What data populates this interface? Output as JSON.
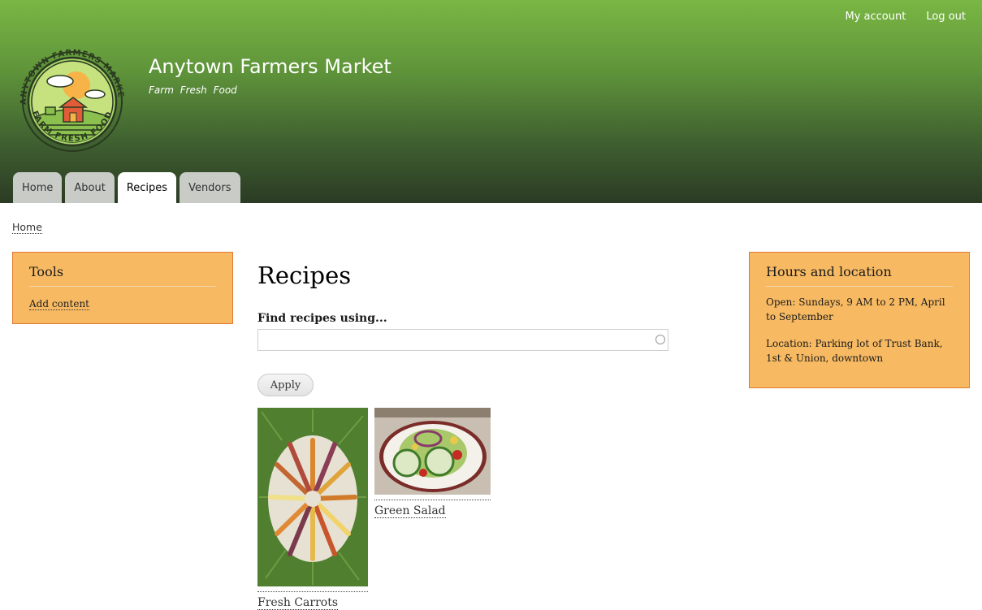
{
  "site": {
    "name": "Anytown Farmers Market",
    "slogan": "Farm Fresh Food"
  },
  "logo": {
    "top_text": "ANYTOWN FARMERS MARKET",
    "bottom_text": "FARM FRESH FOOD"
  },
  "secondary_menu": {
    "my_account": "My account",
    "log_out": "Log out"
  },
  "main_menu": [
    {
      "label": "Home",
      "active": false
    },
    {
      "label": "About",
      "active": false
    },
    {
      "label": "Recipes",
      "active": true
    },
    {
      "label": "Vendors",
      "active": false
    }
  ],
  "breadcrumb": {
    "home": "Home"
  },
  "tools_block": {
    "title": "Tools",
    "link": "Add content"
  },
  "hours_block": {
    "title": "Hours and location",
    "open": "Open: Sundays, 9 AM to 2 PM, April to September",
    "location": "Location: Parking lot of Trust Bank, 1st & Union, downtown"
  },
  "main": {
    "title": "Recipes",
    "filter_label": "Find recipes using...",
    "search_value": "",
    "apply_label": "Apply",
    "recipes": [
      {
        "title": "Fresh Carrots"
      },
      {
        "title": "Green Salad"
      }
    ]
  },
  "colors": {
    "header_top": "#7ab744",
    "header_bottom": "#2b3b24",
    "sidebar_bg": "#f7ba63",
    "sidebar_border": "#e17a32"
  }
}
